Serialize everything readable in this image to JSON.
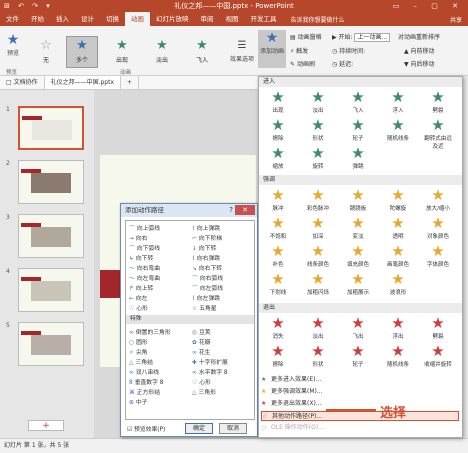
{
  "window": {
    "title": "礼仪之邦——中国.pptx - PowerPoint",
    "qat": "⊞ ↶ ↷ ▾",
    "controls": "▭ – ▢ ✕"
  },
  "tabs": [
    "文件",
    "开始",
    "插入",
    "设计",
    "切换",
    "动画",
    "幻灯片放映",
    "审阅",
    "视图",
    "开发工具"
  ],
  "active_tab": "动画",
  "tell_me": "告诉我你想要做什么",
  "share": "共享",
  "ribbon": {
    "preview_label": "预览",
    "preview_group": "预览",
    "gallery": [
      {
        "label": "无",
        "icon": "☆"
      },
      {
        "label": "多个",
        "icon": "★"
      },
      {
        "label": "出现",
        "icon": "★"
      },
      {
        "label": "淡出",
        "icon": "★"
      },
      {
        "label": "飞入",
        "icon": "★"
      }
    ],
    "effect_options": "效果选项",
    "animation_group": "动画",
    "add_animation": "添加动画",
    "animation_pane": "动画窗格",
    "trigger": "触发",
    "painter": "动画刷",
    "start_label": "开始:",
    "start_value": "上一动画...",
    "duration_label": "持续时间:",
    "delay_label": "延迟:",
    "reorder_title": "对动画重新排序",
    "move_earlier": "向前移动",
    "move_later": "向后移动"
  },
  "file_tabs": [
    "□ 文档协作",
    "礼仪之邦——中国.pptx",
    "+"
  ],
  "slides": [
    {
      "num": "1"
    },
    {
      "num": "2"
    },
    {
      "num": "3"
    },
    {
      "num": "4"
    },
    {
      "num": "5"
    }
  ],
  "status": "幻灯片 第 1 张，共 5 张",
  "dialog": {
    "title": "添加动作路径",
    "help": "?",
    "close": "✕",
    "items_top": [
      [
        "向上弧线",
        "向上弹跳"
      ],
      [
        "向右",
        "向下阶梯"
      ],
      [
        "向下弧线",
        "向下转"
      ],
      [
        "向下转",
        "向右弹跳"
      ],
      [
        "向右弯曲",
        "向右下转"
      ],
      [
        "向左弯曲",
        "向右弧线"
      ],
      [
        "向上转",
        "向左弧线"
      ],
      [
        "向左",
        "向左弹跳"
      ],
      [
        "心形",
        "五角星"
      ]
    ],
    "section": "特殊",
    "items_special": [
      [
        "倒置的三角形",
        "豆荚"
      ],
      [
        "圆形",
        "花瓣"
      ],
      [
        "尖角",
        "花生"
      ],
      [
        "三角结",
        "十字形扩展"
      ],
      [
        "双八串线",
        "水平数字 8"
      ],
      [
        "垂直数字 8",
        "心形"
      ],
      [
        "正方形结",
        "三角形"
      ],
      [
        "中子",
        ""
      ]
    ],
    "preview_check": "预览效果(P)",
    "ok": "确定",
    "cancel": "取消"
  },
  "gallery_dropdown": {
    "sections": [
      {
        "title": "进入",
        "color": "#3d8b6b",
        "items": [
          "出现",
          "淡出",
          "飞入",
          "浮入",
          "劈裂",
          "擦除",
          "形状",
          "轮子",
          "随机线条",
          "翻转式由远及近",
          "缩放",
          "旋转",
          "弹跳"
        ]
      },
      {
        "title": "强调",
        "color": "#e8a82e",
        "items": [
          "脉冲",
          "彩色脉冲",
          "跷跷板",
          "陀螺旋",
          "放大/缩小",
          "不饱和",
          "加深",
          "变淡",
          "透明",
          "对象颜色",
          "补色",
          "线条颜色",
          "填充颜色",
          "画笔颜色",
          "字体颜色",
          "下划线",
          "加粗闪烁",
          "加粗展示",
          "波浪形"
        ]
      },
      {
        "title": "退出",
        "color": "#d23b3b",
        "items": [
          "消失",
          "淡出",
          "飞出",
          "浮出",
          "劈裂",
          "擦除",
          "形状",
          "轮子",
          "随机线条",
          "收缩并旋转"
        ]
      }
    ],
    "menu": [
      {
        "label": "更多进入效果(E)...",
        "state": "normal"
      },
      {
        "label": "更多强调效果(M)...",
        "state": "normal"
      },
      {
        "label": "更多退出效果(X)...",
        "state": "normal"
      },
      {
        "label": "其他动作路径(P)...",
        "state": "highlight"
      },
      {
        "label": "OLE 操作动作(O)...",
        "state": "disabled"
      }
    ]
  },
  "callout": "选择"
}
